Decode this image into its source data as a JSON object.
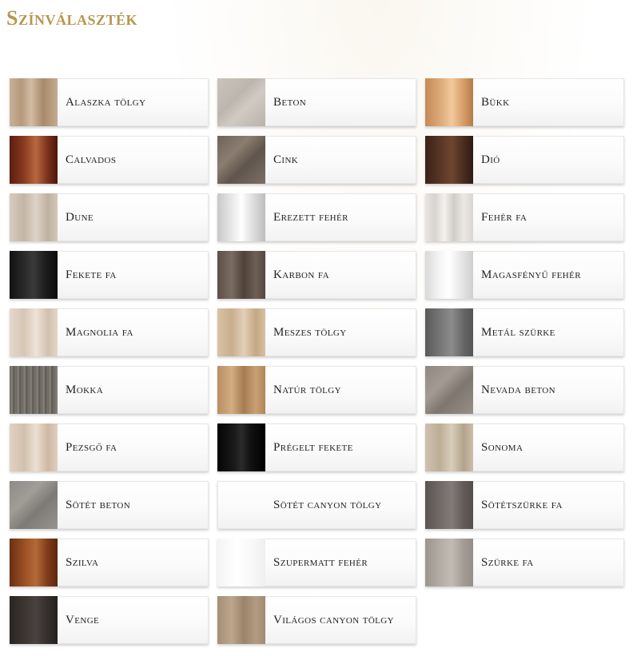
{
  "title": "Színválaszték",
  "swatches": [
    {
      "label": "Alaszka tölgy",
      "bg": "linear-gradient(90deg,#c9b096 0%,#b59a7c 25%,#d3bca4 45%,#a88a6a 70%,#c4ab90 100%)"
    },
    {
      "label": "Beton",
      "bg": "linear-gradient(135deg,#c9c3bc 0%,#bdb6ae 40%,#d0cac3 60%,#b9b2a9 100%)"
    },
    {
      "label": "Bükk",
      "bg": "linear-gradient(90deg,#c48a58 0%,#e0ad7c 35%,#f2c99c 55%,#d69d69 80%,#b57c4b 100%)"
    },
    {
      "label": "Calvados",
      "bg": "linear-gradient(90deg,#5a1e10 0%,#8a3a20 30%,#b8683f 55%,#7a301a 80%,#4a170c 100%)"
    },
    {
      "label": "Cink",
      "bg": "linear-gradient(135deg,#6e6358 0%,#8a7d70 35%,#5f554c 60%,#7c7066 100%)"
    },
    {
      "label": "Dió",
      "bg": "linear-gradient(90deg,#3a2217 0%,#5c3826 35%,#6e4630 55%,#4a2c1d 80%,#2f1b12 100%)"
    },
    {
      "label": "Dune",
      "bg": "linear-gradient(90deg,#d6cbbd 0%,#c3b6a6 30%,#ddd3c7 55%,#bfb1a0 80%,#d2c7b9 100%)"
    },
    {
      "label": "Erezett fehér",
      "bg": "linear-gradient(90deg,#c8c8c8 0%,#e8e8e8 30%,#ffffff 50%,#dcdcdc 75%,#bdbdbd 100%)"
    },
    {
      "label": "Fehér fa",
      "bg": "linear-gradient(90deg,#e9e6e2 0%,#d7d3ce 20%,#f3f1ee 40%,#d0ccc6 60%,#ebe8e4 80%,#d9d5d0 100%)"
    },
    {
      "label": "Fekete fa",
      "bg": "linear-gradient(90deg,#111 0%,#2a2a2a 30%,#3a3a3a 50%,#1c1c1c 75%,#0c0c0c 100%)"
    },
    {
      "label": "Karbon fa",
      "bg": "linear-gradient(90deg,#5d5048 0%,#7b6c61 30%,#4f4239 55%,#6d5f55 80%,#54473f 100%)"
    },
    {
      "label": "Magasfényű fehér",
      "bg": "linear-gradient(90deg,#d9d9d9 0%,#f5f5f5 30%,#ffffff 50%,#e6e6e6 75%,#cfcfcf 100%)"
    },
    {
      "label": "Magnolia fa",
      "bg": "linear-gradient(90deg,#e5d8cb 0%,#d6c6b5 30%,#eee3d8 55%,#d1c0ae 80%,#e3d5c7 100%)"
    },
    {
      "label": "Meszes tölgy",
      "bg": "linear-gradient(90deg,#d9c2a5 0%,#c9ae8d 30%,#e3cfb6 55%,#c5a885 80%,#d8c0a2 100%)"
    },
    {
      "label": "Metál szürke",
      "bg": "linear-gradient(90deg,#5a5a5a 0%,#7a7a7a 35%,#8c8c8c 55%,#666 80%,#555 100%)"
    },
    {
      "label": "Mokka",
      "bg": "repeating-linear-gradient(90deg,#6b6560 0px,#8a847e 3px,#5c5651 5px,#7d7772 8px)"
    },
    {
      "label": "Natúr tölgy",
      "bg": "linear-gradient(90deg,#b98e62 0%,#d4ad82 30%,#a67b51 55%,#c9a074 80%,#b08658 100%)"
    },
    {
      "label": "Nevada beton",
      "bg": "linear-gradient(135deg,#8f8780 0%,#a39b93 35%,#7e766e 60%,#988f87 100%)"
    },
    {
      "label": "Pezsgő fa",
      "bg": "linear-gradient(90deg,#e2d2c2 0%,#d3c0ad 30%,#ecdfd2 55%,#cdb8a3 80%,#e0cfbe 100%)"
    },
    {
      "label": "Prégelt fekete",
      "bg": "linear-gradient(90deg,#050505 0%,#1a1a1a 35%,#2b2b2b 50%,#111 70%,#000 100%)"
    },
    {
      "label": "Sonoma",
      "bg": "linear-gradient(90deg,#cfc2ae 0%,#bcad96 30%,#d9cdbb 55%,#b3a38b 80%,#cbbda8 100%)"
    },
    {
      "label": "Sötét beton",
      "bg": "linear-gradient(135deg,#8d8b86 0%,#a09d97 35%,#7c7a75 60%,#979490 100%)"
    },
    {
      "label": "Sötét canyon tölgy",
      "bg": "linear-gradient(90deg,#7a6a5b 0%,#968574 30%,#6b5c4e 55%,#8b7a69 80%,#72625 100%)"
    },
    {
      "label": "Sötétszürke fa",
      "bg": "linear-gradient(90deg,#5a5452 0%,#746d6a 35%,#827b78 55%,#625b58 80%,#544e4c 100%)"
    },
    {
      "label": "Szilva",
      "bg": "linear-gradient(90deg,#6a2f12 0%,#9a4f22 30%,#b36a38 55%,#7e3a18 80%,#5c270f 100%)"
    },
    {
      "label": "Szupermatt fehér",
      "bg": "linear-gradient(90deg,#f4f4f4 0%,#ffffff 40%,#f9f9f9 70%,#efefef 100%)"
    },
    {
      "label": "Szürke fa",
      "bg": "linear-gradient(90deg,#9c958e 0%,#b6afa8 35%,#c2bbb4 55%,#a39c95 80%,#958e87 100%)"
    },
    {
      "label": "Venge",
      "bg": "linear-gradient(90deg,#2a2523 0%,#3e3734 35%,#4a4240 55%,#332d2b 80%,#241f1d 100%)"
    },
    {
      "label": "Világos canyon tölgy",
      "bg": "linear-gradient(90deg,#a58f76 0%,#bca68c 30%,#9a8369 55%,#b29b81 80%,#a08a70 100%)"
    }
  ]
}
